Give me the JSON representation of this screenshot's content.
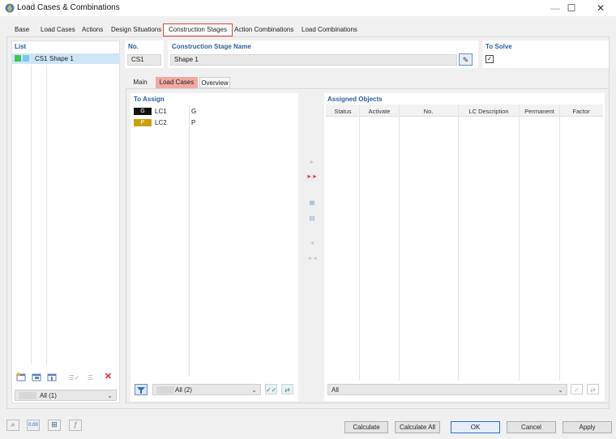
{
  "window": {
    "title": "Load Cases & Combinations"
  },
  "top_tabs": [
    "Base",
    "Load Cases",
    "Actions",
    "Design Situations",
    "Construction Stages",
    "Action Combinations",
    "Load Combinations"
  ],
  "list": {
    "header": "List",
    "items": [
      {
        "code": "CS1",
        "name": "Shape 1",
        "color1": "#3cc45a",
        "color2": "#7fc8f0"
      }
    ],
    "filter_value": "All (1)"
  },
  "no": {
    "label": "No.",
    "value": "CS1"
  },
  "stage_name": {
    "label": "Construction Stage Name",
    "value": "Shape 1"
  },
  "to_solve": {
    "label": "To Solve",
    "checked_glyph": "✓"
  },
  "sub_tabs": [
    "Main",
    "Load Cases",
    "Overview"
  ],
  "to_assign": {
    "header": "To Assign",
    "rows": [
      {
        "badge": "G",
        "badge_bg": "#111111",
        "badge_fg": "#ffffff",
        "lc": "LC1",
        "type": "G"
      },
      {
        "badge": "P",
        "badge_bg": "#c9a10a",
        "badge_fg": "#ffffff",
        "lc": "LC2",
        "type": "P"
      }
    ],
    "filter_value": "All (2)"
  },
  "assigned": {
    "header": "Assigned Objects",
    "columns": [
      "Status",
      "Activate",
      "No.",
      "LC Description",
      "Permanent",
      "Factor"
    ],
    "filter_value": "All"
  },
  "buttons": {
    "calculate": "Calculate",
    "calculate_all": "Calculate All",
    "ok": "OK",
    "cancel": "Cancel",
    "apply": "Apply"
  },
  "footer_icons": [
    "search-icon",
    "units-icon",
    "table-icon",
    "function-icon"
  ],
  "colors": {
    "accent_blue": "#2b5f9e",
    "highlight_red": "#e0403a",
    "selection": "#cde6f7",
    "active_subtab": "#f2a9a3"
  }
}
